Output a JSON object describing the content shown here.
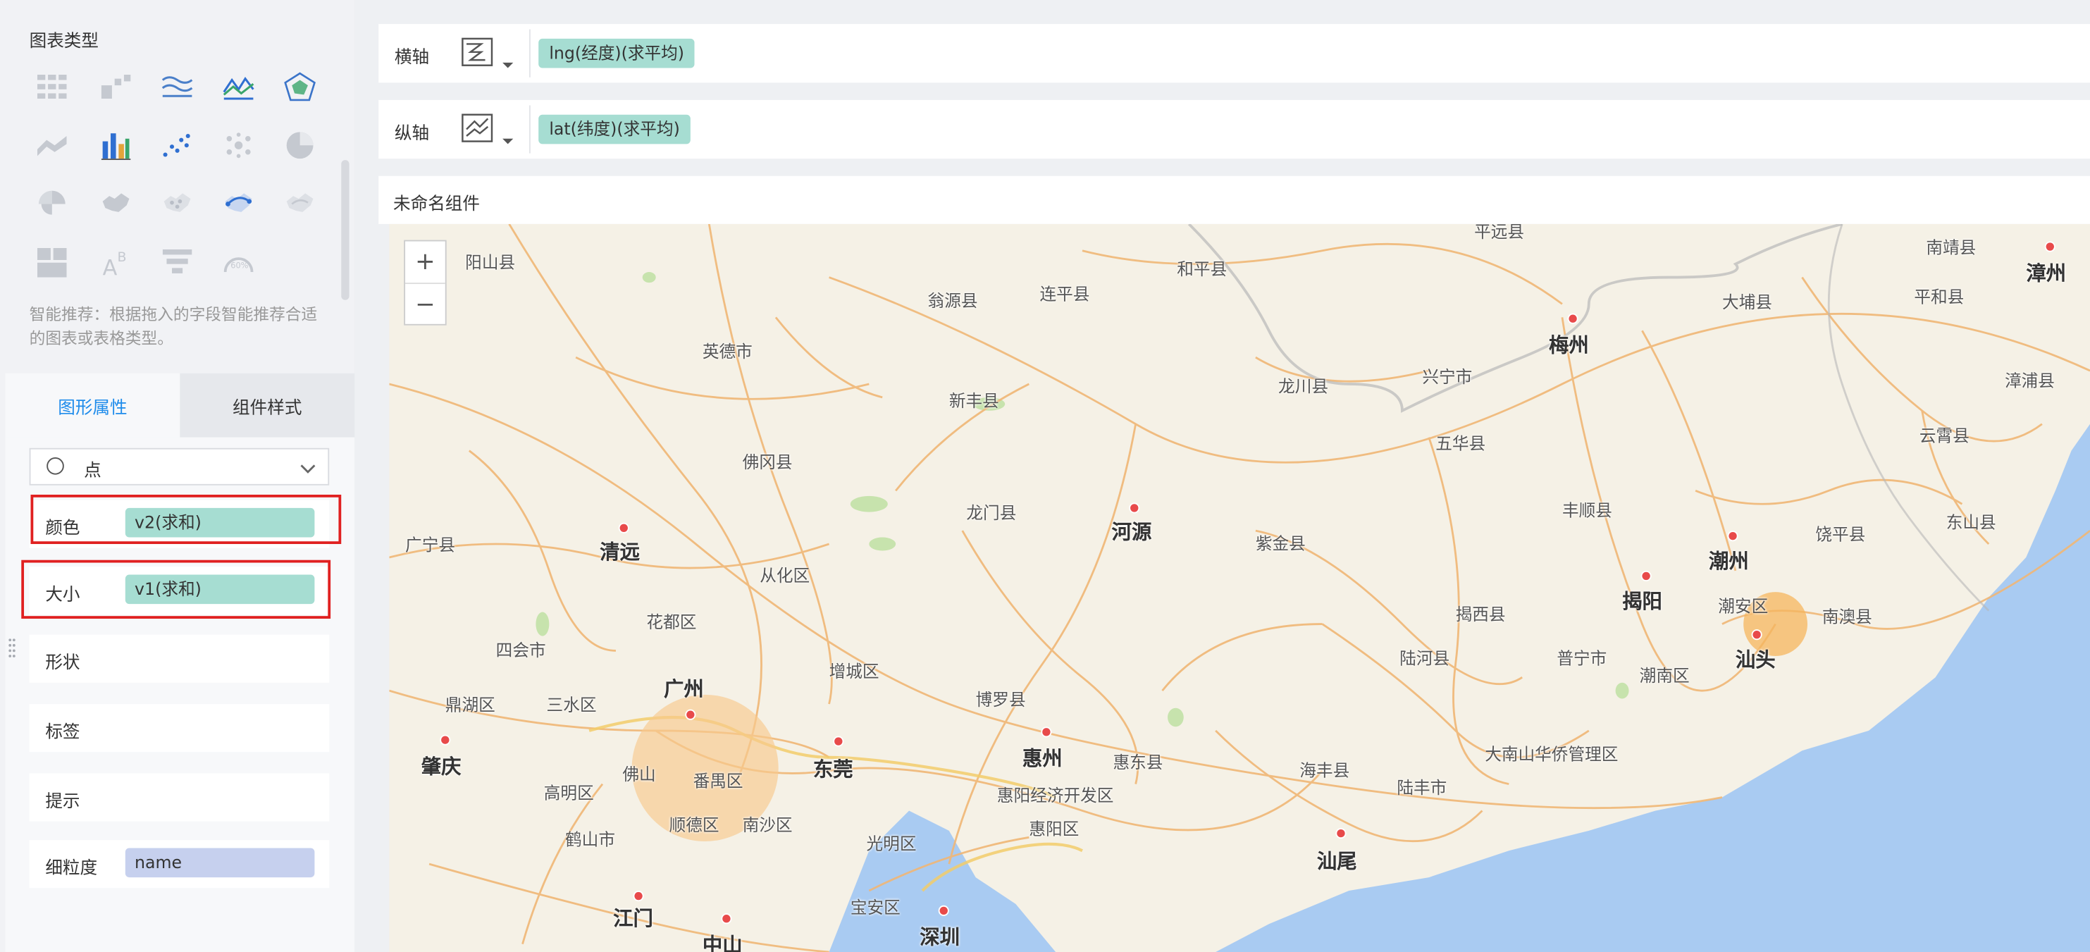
{
  "left_panel": {
    "chart_type_title": "图表类型",
    "chart_types": [
      "table-icon",
      "cross-table-icon",
      "multi-line-icon",
      "line-icon",
      "radar-icon",
      "area-icon",
      "bar-icon",
      "scatter-icon",
      "bubble-icon",
      "pie-icon",
      "rose-icon",
      "map-fill-icon",
      "map-point-icon",
      "map-flow-icon",
      "map-heat-icon",
      "card-icon",
      "text-icon",
      "funnel-icon",
      "gauge-icon"
    ],
    "hint": "智能推荐：根据拖入的字段智能推荐合适的图表或表格类型。",
    "tabs": {
      "graph_props": "图形属性",
      "component_style": "组件样式"
    },
    "mark_type": "点",
    "properties": [
      {
        "label": "颜色",
        "field": "v2(求和)"
      },
      {
        "label": "大小",
        "field": "v1(求和)"
      },
      {
        "label": "形状",
        "field": ""
      },
      {
        "label": "标签",
        "field": ""
      },
      {
        "label": "提示",
        "field": ""
      },
      {
        "label": "细粒度",
        "field": "name"
      }
    ]
  },
  "axes": {
    "x": {
      "label": "横轴",
      "field": "lng(经度)(求平均)"
    },
    "y": {
      "label": "纵轴",
      "field": "lat(纬度)(求平均)"
    }
  },
  "component_title": "未命名组件",
  "map": {
    "zoom_in": "+",
    "zoom_out": "−",
    "places": {
      "yangshan": "阳山县",
      "wengyuan": "翁源县",
      "lianping": "连平县",
      "heping": "和平县",
      "pingyuan_top": "平远县",
      "nanjing": "南靖县",
      "zhangzhou": "漳州",
      "dapu": "大埔县",
      "pinghe": "平和县",
      "meizhou": "梅州",
      "yingde": "英德市",
      "xinfeng": "新丰县",
      "longchuan": "龙川县",
      "xingning": "兴宁市",
      "zhangpu": "漳浦县",
      "wuhua": "五华县",
      "yunxiao": "云霄县",
      "fogang": "佛冈县",
      "longmen": "龙门县",
      "heyuan": "河源",
      "fengshun": "丰顺县",
      "dongshan": "东山县",
      "guangning": "广宁县",
      "qingyuan": "清远",
      "zijin": "紫金县",
      "chaozhou": "潮州",
      "raoping": "饶平县",
      "conghua": "从化区",
      "jieyang": "揭阳",
      "chaoan": "潮安区",
      "nanao": "南澳县",
      "jiexi": "揭西县",
      "huadu": "花都区",
      "sihui": "四会市",
      "zengcheng": "增城区",
      "lufeng_river": "陆河县",
      "puning": "普宁市",
      "shantou": "汕头",
      "chaonan": "潮南区",
      "dinghu": "鼎湖区",
      "sanshui": "三水区",
      "guangzhou": "广州",
      "boluo": "博罗县",
      "zhaoqing": "肇庆",
      "foshan": "佛山",
      "panyu": "番禺区",
      "dongguan": "东莞",
      "huizhou": "惠州",
      "huidong": "惠东县",
      "haifeng": "海丰县",
      "danan": "大南山华侨管理区",
      "gaoming": "高明区",
      "shunde": "顺德区",
      "nansha": "南沙区",
      "huiyang_econ": "惠阳经济开发区",
      "lufeng": "陆丰市",
      "heshan": "鹤山市",
      "guangming": "光明区",
      "huiyang": "惠阳区",
      "shanwei": "汕尾",
      "jiangmen": "江门",
      "baoan": "宝安区",
      "zhongshan": "中山",
      "shenzhen": "深圳"
    }
  }
}
